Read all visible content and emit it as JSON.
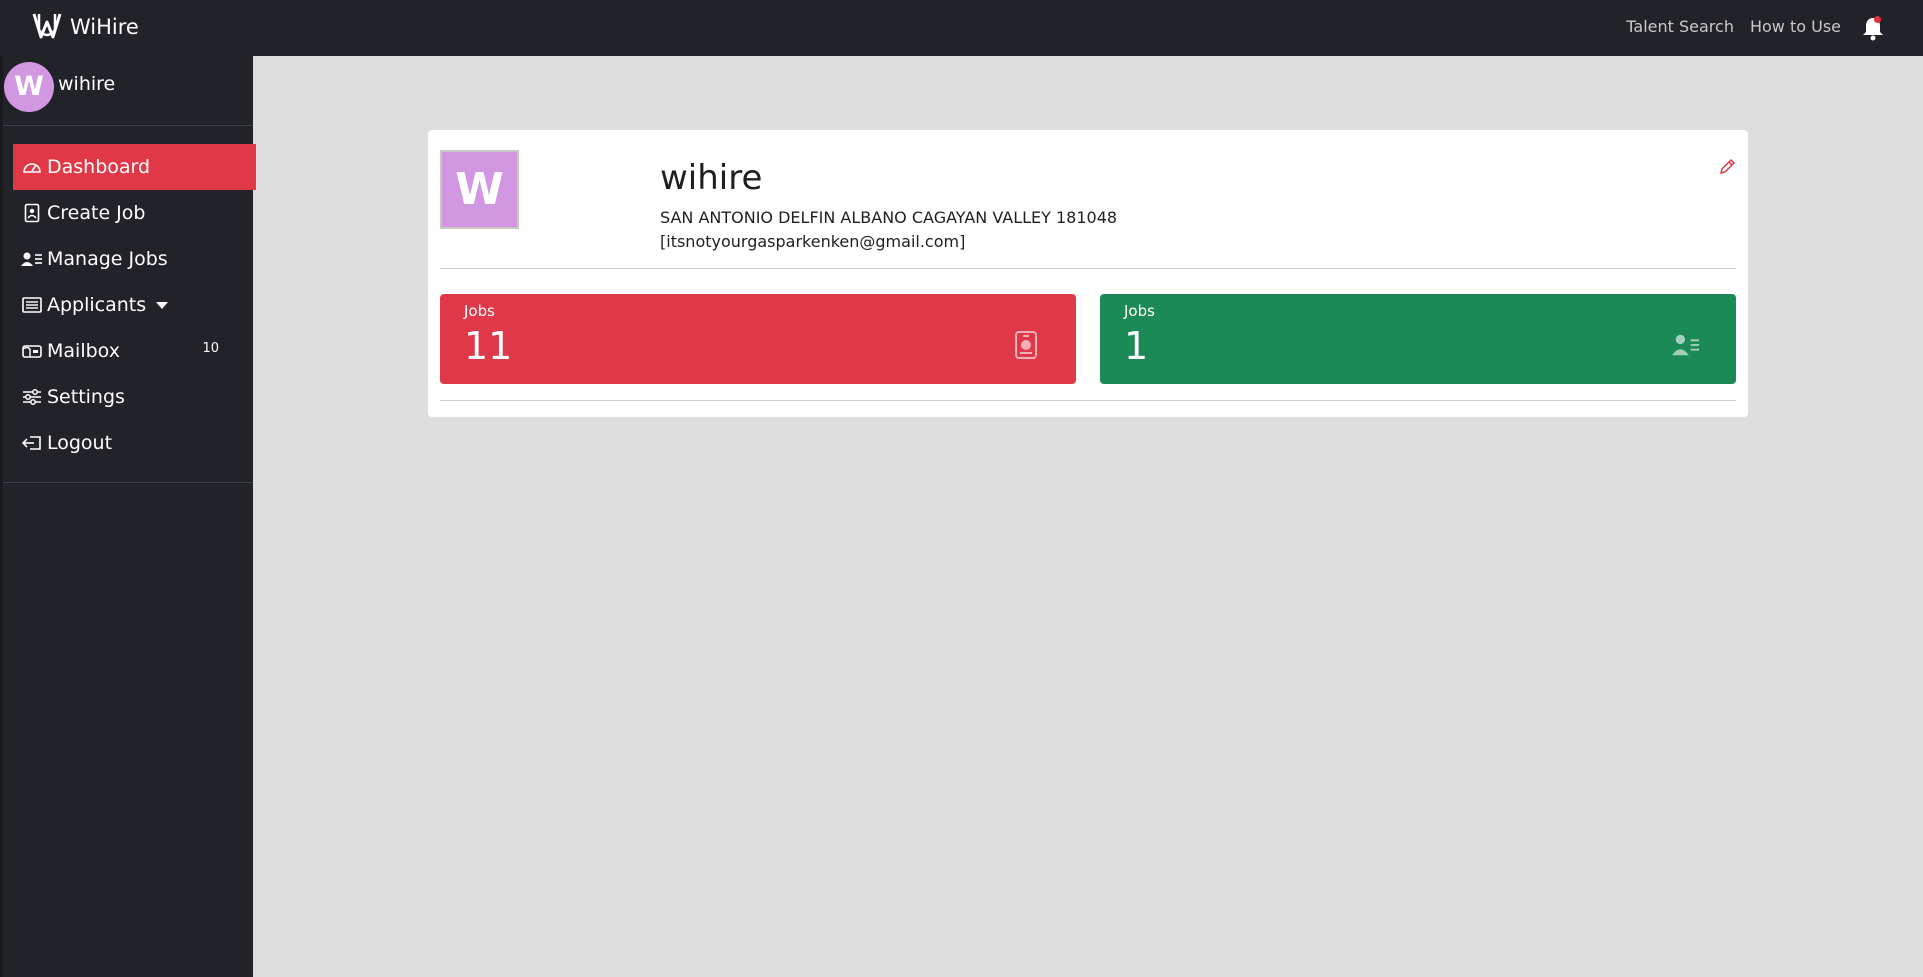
{
  "header": {
    "brand": "WiHire",
    "nav": [
      "Talent Search",
      "How to Use"
    ],
    "notification_icon": "bell-icon",
    "notification_dot_color": "#e0303f"
  },
  "sidebar": {
    "user": {
      "initial": "W",
      "name": "wihire"
    },
    "items": [
      {
        "label": "Dashboard",
        "icon": "dashboard-icon",
        "active": true
      },
      {
        "label": "Create Job",
        "icon": "create-job-icon"
      },
      {
        "label": "Manage Jobs",
        "icon": "manage-jobs-icon"
      },
      {
        "label": "Applicants",
        "icon": "applicants-icon",
        "dropdown": true
      },
      {
        "label": "Mailbox",
        "icon": "mailbox-icon",
        "badge": "10"
      },
      {
        "label": "Settings",
        "icon": "settings-icon"
      },
      {
        "label": "Logout",
        "icon": "logout-icon"
      }
    ]
  },
  "profile": {
    "initial": "W",
    "name": "wihire",
    "address": "SAN ANTONIO DELFIN ALBANO CAGAYAN VALLEY 181048",
    "email": "[itsnotyourgasparkenken@gmail.com]"
  },
  "stats": [
    {
      "label": "Jobs",
      "value": "11",
      "color": "#df3848",
      "icon": "id-badge-icon"
    },
    {
      "label": "Jobs",
      "value": "1",
      "color": "#1b8a56",
      "icon": "people-list-icon"
    }
  ],
  "colors": {
    "accent": "#e13848",
    "sidebar_bg": "#212328",
    "avatar": "#d297e1"
  }
}
